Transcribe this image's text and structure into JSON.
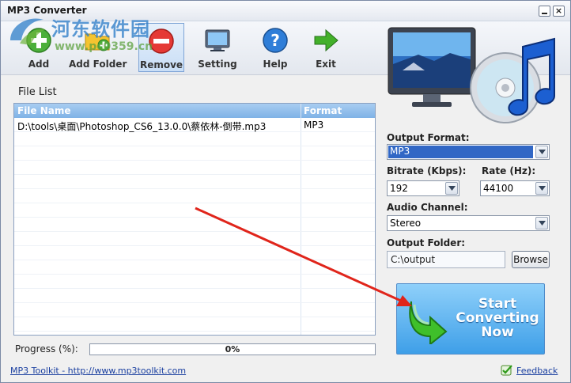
{
  "window": {
    "title": "MP3 Converter"
  },
  "watermark": {
    "text1": "河东软件园",
    "text2": "www.pc0359.cn"
  },
  "toolbar": {
    "add_label": "Add",
    "add_folder_label": "Add Folder",
    "remove_label": "Remove",
    "setting_label": "Setting",
    "help_label": "Help",
    "exit_label": "Exit"
  },
  "file_list": {
    "title": "File List",
    "columns": [
      "File Name",
      "Format"
    ],
    "rows": [
      {
        "name": "D:\\tools\\桌面\\Photoshop_CS6_13.0.0\\蔡依林-倒带.mp3",
        "format": "MP3"
      }
    ]
  },
  "progress": {
    "label": "Progress (%):",
    "value": 0,
    "text": "0%"
  },
  "settings": {
    "output_format_label": "Output Format:",
    "output_format_value": "MP3",
    "bitrate_label": "Bitrate (Kbps):",
    "bitrate_value": "192",
    "rate_label": "Rate (Hz):",
    "rate_value": "44100",
    "channel_label": "Audio Channel:",
    "channel_value": "Stereo",
    "folder_label": "Output Folder:",
    "folder_value": "C:\\output",
    "browse_label": "Browse"
  },
  "start": {
    "line1": "Start",
    "line2": "Converting",
    "line3": "Now"
  },
  "footer": {
    "link_text": "MP3 Toolkit - http://www.mp3toolkit.com",
    "feedback_text": "Feedback"
  },
  "colors": {
    "accent": "#3e9fe8",
    "header": "#7fb2e6",
    "selection": "#3167c5",
    "annotation_arrow": "#e0251b"
  }
}
